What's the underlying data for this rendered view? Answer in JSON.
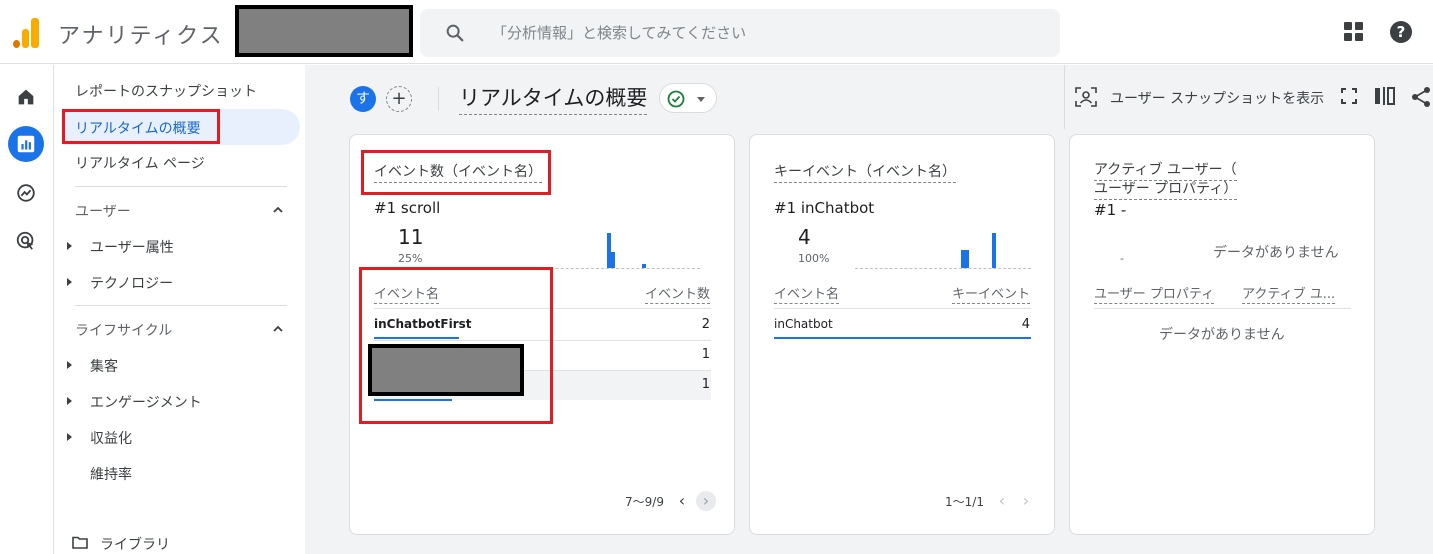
{
  "topbar": {
    "app_title": "アナリティクス",
    "search_placeholder": "「分析情報」と検索してみてください"
  },
  "sidebar": {
    "snapshot": "レポートのスナップショット",
    "realtime_overview": "リアルタイムの概要",
    "realtime_page": "リアルタイム ページ",
    "section_user": "ユーザー",
    "user_items": [
      "ユーザー属性",
      "テクノロジー"
    ],
    "section_lifecycle": "ライフサイクル",
    "lifecycle_items": [
      "集客",
      "エンゲージメント",
      "収益化",
      "維持率"
    ],
    "library": "ライブラリ"
  },
  "header": {
    "avatar_letter": "す",
    "add": "+",
    "page_title": "リアルタイムの概要",
    "snapshot_button": "ユーザー スナップショットを表示"
  },
  "cards": {
    "events": {
      "title": "イベント数（イベント名）",
      "rank": "#1  scroll",
      "value": "11",
      "percent": "25%",
      "sparkline": [
        0,
        0,
        0,
        0,
        0,
        0,
        0,
        0,
        0,
        0,
        0,
        0,
        0,
        0,
        0,
        0,
        0,
        0,
        0,
        0,
        0,
        0,
        0,
        0,
        9,
        4,
        0,
        0,
        0,
        0,
        0,
        0,
        1,
        0,
        0,
        0,
        0,
        0,
        0,
        0,
        0,
        0,
        0,
        0,
        0
      ],
      "col_name": "イベント名",
      "col_value": "イベント数",
      "rows": [
        {
          "name": "inChatbotFirst",
          "value": "2"
        },
        {
          "name": "",
          "value": "1"
        },
        {
          "name": "",
          "value": "1"
        }
      ],
      "pager": "7〜9/9"
    },
    "key_events": {
      "title": "キーイベント（イベント名）",
      "rank": "#1  inChatbot",
      "value": "4",
      "percent": "100%",
      "sparkline": [
        0,
        0,
        0,
        0,
        0,
        0,
        0,
        0,
        0,
        0,
        0,
        0,
        0,
        0,
        0,
        0,
        0,
        0,
        0,
        0,
        0,
        0,
        0,
        0,
        0,
        0,
        0,
        1,
        1,
        0,
        0,
        0,
        0,
        0,
        0,
        2,
        0,
        0,
        0,
        0,
        0,
        0,
        0,
        0,
        0
      ],
      "col_name": "イベント名",
      "col_value": "キーイベント",
      "rows": [
        {
          "name": "inChatbot",
          "value": "4"
        }
      ],
      "pager": "1〜1/1"
    },
    "active_users": {
      "title_line1": "アクティブ ユーザー（",
      "title_line2": "ユーザー プロパティ）",
      "rank": "#1  -",
      "dash": "-",
      "no_data": "データがありません",
      "col_name": "ユーザー プロパティ",
      "col_value": "アクティブ ユ...",
      "table_no_data": "データがありません"
    }
  },
  "colors": {
    "accent": "#1a73e8",
    "highlight_box": "#e31b23",
    "logo_orange": "#f9ab00",
    "logo_dark_orange": "#e37400"
  }
}
